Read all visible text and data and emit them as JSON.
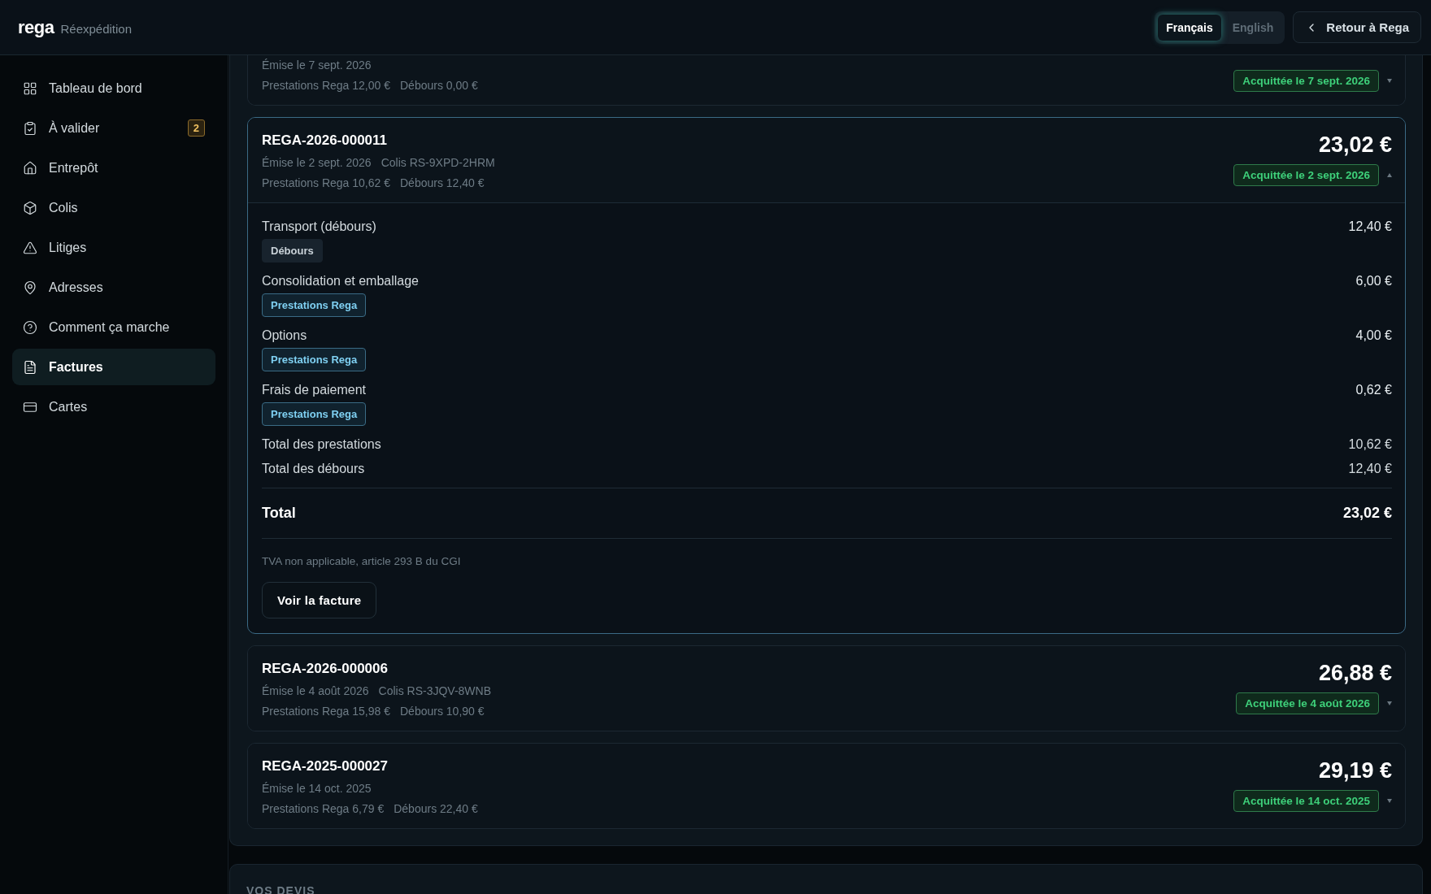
{
  "header": {
    "logo": "rega",
    "subtitle": "Réexpédition",
    "languages": [
      {
        "label": "Français",
        "selected": true
      },
      {
        "label": "English",
        "selected": false
      }
    ],
    "back_button": "Retour à Rega"
  },
  "sidebar": {
    "items": [
      {
        "label": "Tableau de bord",
        "selected": false
      },
      {
        "label": "À valider",
        "selected": false,
        "badge": "2"
      },
      {
        "label": "Entrepôt",
        "selected": false
      },
      {
        "label": "Colis",
        "selected": false
      },
      {
        "label": "Litiges",
        "selected": false
      },
      {
        "label": "Adresses",
        "selected": false
      },
      {
        "label": "Comment ça marche",
        "selected": false
      },
      {
        "label": "Factures",
        "selected": true
      },
      {
        "label": "Cartes",
        "selected": false
      }
    ]
  },
  "invoices": [
    {
      "issued": "Émise le 7 sept. 2026",
      "prestations": "Prestations Rega 12,00 €",
      "debours": "Débours 0,00 €",
      "status": "Acquittée le 7 sept. 2026",
      "expanded": false
    },
    {
      "number": "REGA-2026-000011",
      "amount": "23,02 €",
      "issued": "Émise le 2 sept. 2026",
      "parcel": "Colis RS-9XPD-2HRM",
      "prestations": "Prestations Rega 10,62 €",
      "debours": "Débours 12,40 €",
      "status": "Acquittée le 2 sept. 2026",
      "expanded": true,
      "detail": {
        "lines": [
          {
            "label": "Transport (débours)",
            "amount": "12,40 €",
            "tag": {
              "label": "Débours",
              "kind": "debours"
            }
          },
          {
            "label": "Consolidation et emballage",
            "amount": "6,00 €",
            "tag": {
              "label": "Prestations Rega",
              "kind": "prestations"
            }
          },
          {
            "label": "Options",
            "amount": "4,00 €",
            "tag": {
              "label": "Prestations Rega",
              "kind": "prestations"
            }
          },
          {
            "label": "Frais de paiement",
            "amount": "0,62 €",
            "tag": {
              "label": "Prestations Rega",
              "kind": "prestations"
            }
          }
        ],
        "totals": [
          {
            "label": "Total des prestations",
            "amount": "10,62 €"
          },
          {
            "label": "Total des débours",
            "amount": "12,40 €"
          }
        ],
        "total": {
          "label": "Total",
          "amount": "23,02 €"
        },
        "note": "TVA non applicable, article 293 B du CGI",
        "button": "Voir la facture"
      }
    },
    {
      "number": "REGA-2026-000006",
      "amount": "26,88 €",
      "issued": "Émise le 4 août 2026",
      "parcel": "Colis RS-3JQV-8WNB",
      "prestations": "Prestations Rega 15,98 €",
      "debours": "Débours 10,90 €",
      "status": "Acquittée le 4 août 2026",
      "expanded": false
    },
    {
      "number": "REGA-2025-000027",
      "amount": "29,19 €",
      "issued": "Émise le 14 oct. 2025",
      "prestations": "Prestations Rega 6,79 €",
      "debours": "Débours 22,40 €",
      "status": "Acquittée le 14 oct. 2025",
      "expanded": false
    }
  ],
  "quotes": {
    "title": "VOS DEVIS"
  }
}
